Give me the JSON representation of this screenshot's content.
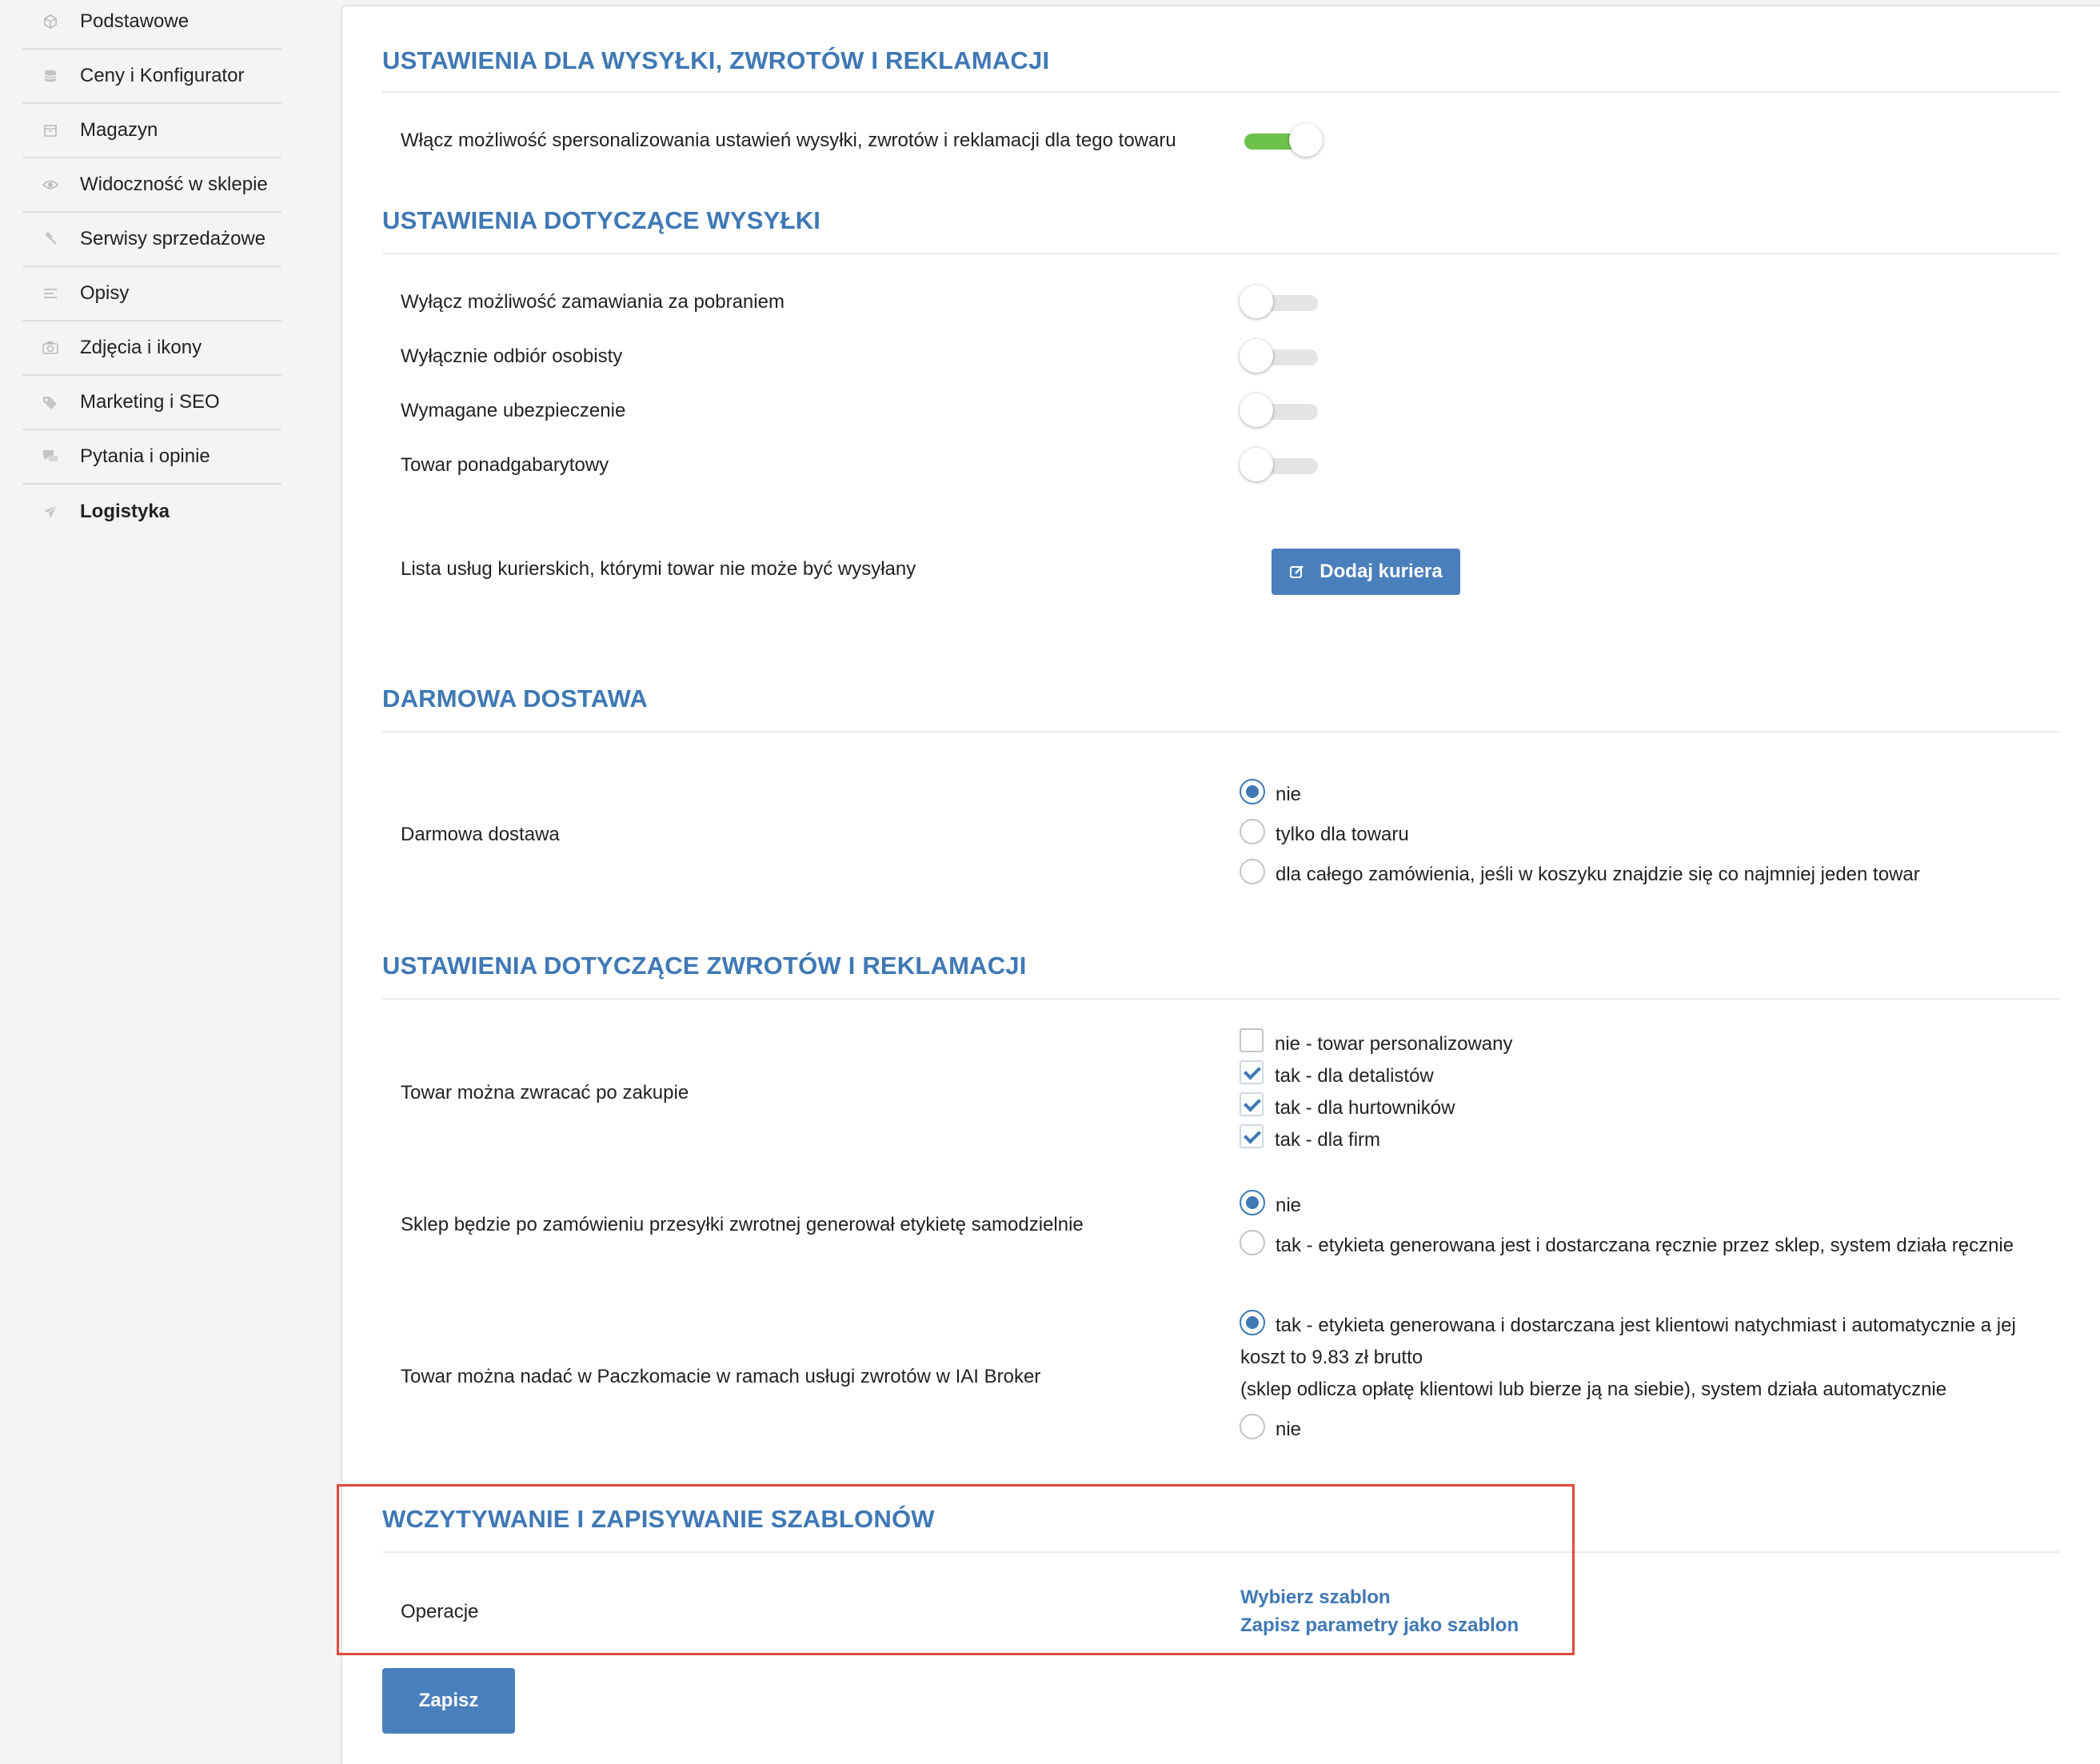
{
  "sidebar": {
    "items": [
      {
        "label": "Podstawowe",
        "icon": "cube-icon"
      },
      {
        "label": "Ceny i Konfigurator",
        "icon": "coins-icon"
      },
      {
        "label": "Magazyn",
        "icon": "box-icon"
      },
      {
        "label": "Widoczność w sklepie",
        "icon": "eye-icon"
      },
      {
        "label": "Serwisy sprzedażowe",
        "icon": "gavel-icon"
      },
      {
        "label": "Opisy",
        "icon": "text-lines-icon"
      },
      {
        "label": "Zdjęcia i ikony",
        "icon": "camera-icon"
      },
      {
        "label": "Marketing i SEO",
        "icon": "tags-icon"
      },
      {
        "label": "Pytania i opinie",
        "icon": "chat-icon"
      },
      {
        "label": "Logistyka",
        "icon": "paper-plane-icon",
        "active": true
      }
    ]
  },
  "sections": {
    "s1": {
      "title": "USTAWIENIA DLA WYSYŁKI, ZWROTÓW I REKLAMACJI",
      "personalize_label": "Włącz możliwość spersonalizowania ustawień wysyłki, zwrotów i reklamacji dla tego towaru",
      "personalize_on": true
    },
    "s2": {
      "title": "USTAWIENIA DOTYCZĄCE WYSYŁKI",
      "toggles": [
        {
          "label": "Wyłącz możliwość zamawiania za pobraniem",
          "on": false
        },
        {
          "label": "Wyłącznie odbiór osobisty",
          "on": false
        },
        {
          "label": "Wymagane ubezpieczenie",
          "on": false
        },
        {
          "label": "Towar ponadgabarytowy",
          "on": false
        }
      ],
      "courier_label": "Lista usług kurierskich, którymi towar nie może być wysyłany",
      "add_courier_button": "Dodaj kuriera"
    },
    "s3": {
      "title": "DARMOWA DOSTAWA",
      "label": "Darmowa dostawa",
      "options": [
        "nie",
        "tylko dla towaru",
        "dla całego zamówienia, jeśli w koszyku znajdzie się co najmniej jeden towar"
      ],
      "selected": 0
    },
    "s4": {
      "title": "USTAWIENIA DOTYCZĄCE ZWROTÓW I REKLAMACJI",
      "returns_label": "Towar można zwracać po zakupie",
      "returns_options": [
        {
          "label": "nie - towar personalizowany",
          "checked": false
        },
        {
          "label": "tak - dla detalistów",
          "checked": true
        },
        {
          "label": "tak - dla hurtowników",
          "checked": true
        },
        {
          "label": "tak - dla firm",
          "checked": true
        }
      ],
      "label_gen_label": "Sklep będzie po zamówieniu przesyłki zwrotnej generował etykietę samodzielnie",
      "label_gen_options": [
        "nie",
        "tak - etykieta generowana jest i dostarczana ręcznie przez sklep, system działa ręcznie"
      ],
      "label_gen_selected": 0,
      "paczkomat_label": "Towar można nadać w Paczkomacie w ramach usługi zwrotów w IAI Broker",
      "paczkomat_opt1_line1": "tak - etykieta generowana i dostarczana jest klientowi natychmiast i automatycznie a jej",
      "paczkomat_opt1_line2": "koszt to 9.83 zł brutto",
      "paczkomat_opt1_line3": "(sklep odlicza opłatę klientowi lub bierze ją na siebie), system działa automatycznie",
      "paczkomat_opt2": "nie",
      "paczkomat_selected": 0
    },
    "s5": {
      "title": "WCZYTYWANIE I ZAPISYWANIE SZABLONÓW",
      "label": "Operacje",
      "link1": "Wybierz szablon",
      "link2": "Zapisz parametry jako szablon"
    }
  },
  "save_button": "Zapisz",
  "colors": {
    "accent": "#3f78b5",
    "toggle_on": "#6cc24a",
    "highlight": "#e04b3c"
  }
}
